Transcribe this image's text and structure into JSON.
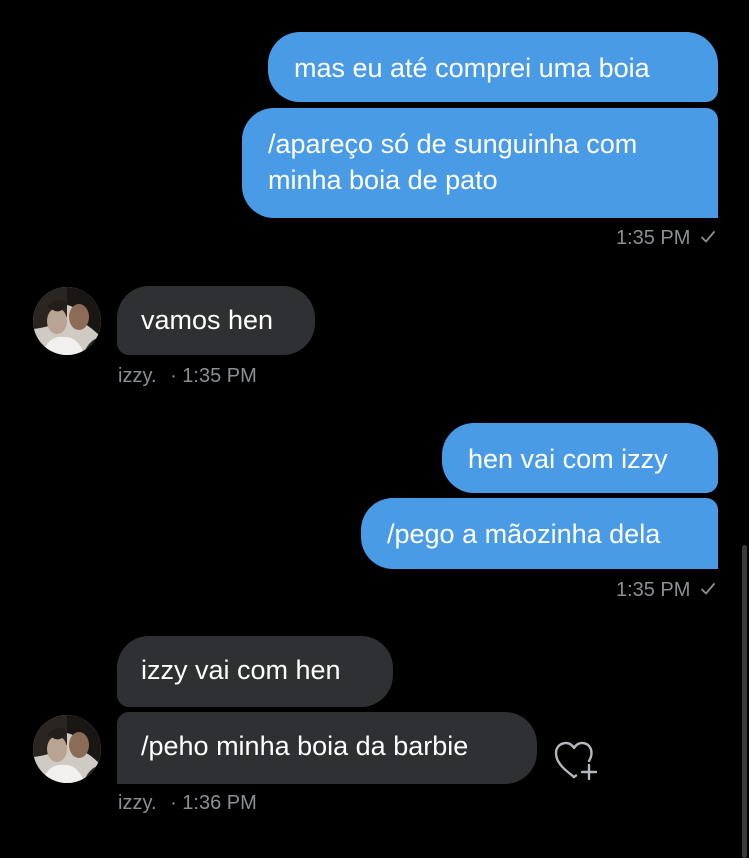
{
  "conversation": {
    "group1": {
      "msg1": "mas eu até comprei uma boia",
      "msg2_line1": "/apareço só de sunguinha com",
      "msg2_line2": "minha boia de pato",
      "time": "1:35 PM",
      "status_icon": "check-icon"
    },
    "group2": {
      "msg1": "vamos hen",
      "sender": "izzy.",
      "time": "· 1:35 PM"
    },
    "group3": {
      "msg1": "hen vai com izzy",
      "msg2": "/pego a mãozinha dela",
      "time": "1:35 PM",
      "status_icon": "check-icon"
    },
    "group4": {
      "msg1": "izzy vai com hen",
      "msg2": "/peho minha boia da barbie",
      "sender": "izzy.",
      "time": "· 1:36 PM",
      "reaction_icon": "heart-plus-icon"
    }
  },
  "colors": {
    "outgoing": "#4a9be6",
    "incoming": "#2f3033",
    "meta": "#8b8f94",
    "background": "#000000"
  }
}
